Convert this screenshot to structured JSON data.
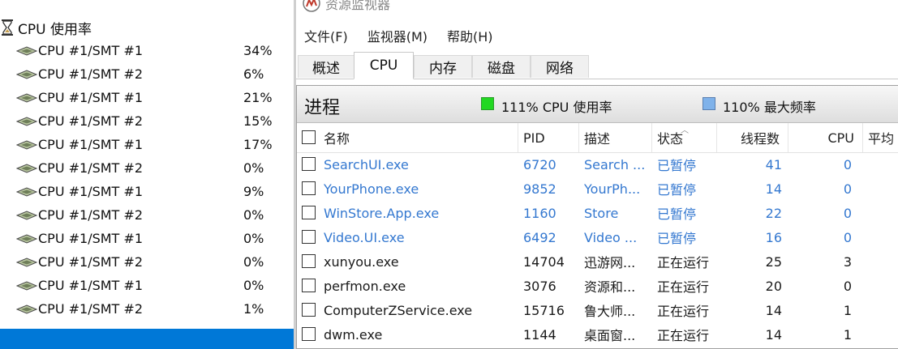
{
  "left_pane": {
    "header": "CPU 使用率",
    "cores": [
      {
        "name": "CPU #1/SMT #1",
        "value": "34%"
      },
      {
        "name": "CPU #1/SMT #2",
        "value": "6%"
      },
      {
        "name": "CPU #1/SMT #1",
        "value": "21%"
      },
      {
        "name": "CPU #1/SMT #2",
        "value": "15%"
      },
      {
        "name": "CPU #1/SMT #1",
        "value": "17%"
      },
      {
        "name": "CPU #1/SMT #2",
        "value": "0%"
      },
      {
        "name": "CPU #1/SMT #1",
        "value": "9%"
      },
      {
        "name": "CPU #1/SMT #2",
        "value": "0%"
      },
      {
        "name": "CPU #1/SMT #1",
        "value": "0%"
      },
      {
        "name": "CPU #1/SMT #2",
        "value": "0%"
      },
      {
        "name": "CPU #1/SMT #1",
        "value": "0%"
      },
      {
        "name": "CPU #1/SMT #2",
        "value": "1%"
      }
    ],
    "selection_color": "#0078d7"
  },
  "window": {
    "title": "资源监视器",
    "menu": [
      "文件(F)",
      "监视器(M)",
      "帮助(H)"
    ],
    "tabs": [
      "概述",
      "CPU",
      "内存",
      "磁盘",
      "网络"
    ],
    "active_tab": "CPU",
    "section": {
      "title": "进程",
      "cpu_usage": "111% CPU 使用率",
      "max_frequency": "110% 最大频率",
      "usage_color": "#22d822",
      "frequency_color": "#7fb2ea"
    },
    "columns": [
      "名称",
      "PID",
      "描述",
      "状态",
      "线程数",
      "CPU",
      "平均"
    ],
    "processes": [
      {
        "name": "SearchUI.exe",
        "pid": "6720",
        "desc": "Search ...",
        "status": "已暂停",
        "threads": "41",
        "cpu": "0",
        "avg": "",
        "suspended": true
      },
      {
        "name": "YourPhone.exe",
        "pid": "9852",
        "desc": "YourPh...",
        "status": "已暂停",
        "threads": "14",
        "cpu": "0",
        "avg": "",
        "suspended": true
      },
      {
        "name": "WinStore.App.exe",
        "pid": "1160",
        "desc": "Store",
        "status": "已暂停",
        "threads": "22",
        "cpu": "0",
        "avg": "",
        "suspended": true
      },
      {
        "name": "Video.UI.exe",
        "pid": "6492",
        "desc": "Video ...",
        "status": "已暂停",
        "threads": "16",
        "cpu": "0",
        "avg": "",
        "suspended": true
      },
      {
        "name": "xunyou.exe",
        "pid": "14704",
        "desc": "迅游网...",
        "status": "正在运行",
        "threads": "25",
        "cpu": "3",
        "avg": "",
        "suspended": false
      },
      {
        "name": "perfmon.exe",
        "pid": "3076",
        "desc": "资源和...",
        "status": "正在运行",
        "threads": "20",
        "cpu": "0",
        "avg": "",
        "suspended": false
      },
      {
        "name": "ComputerZService.exe",
        "pid": "15716",
        "desc": "鲁大师...",
        "status": "正在运行",
        "threads": "14",
        "cpu": "1",
        "avg": "",
        "suspended": false
      },
      {
        "name": "dwm.exe",
        "pid": "1144",
        "desc": "桌面窗...",
        "status": "正在运行",
        "threads": "14",
        "cpu": "1",
        "avg": "",
        "suspended": false
      }
    ],
    "suspended_color": "#3478d0"
  }
}
